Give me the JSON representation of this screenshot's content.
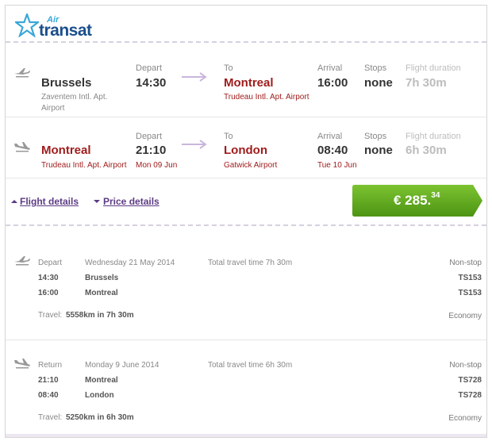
{
  "brand": {
    "air": "Air",
    "transat": "transat"
  },
  "outbound": {
    "from_city": "Brussels",
    "from_airport": "Zaventem Intl. Apt. Airport",
    "depart_label": "Depart",
    "depart_time": "14:30",
    "to_label": "To",
    "to_city": "Montreal",
    "to_airport": "Trudeau Intl. Apt. Airport",
    "arrival_label": "Arrival",
    "arrival_time": "16:00",
    "stops_label": "Stops",
    "stops": "none",
    "duration_label": "Flight duration",
    "duration": "7h 30m"
  },
  "return": {
    "from_city": "Montreal",
    "from_airport": "Trudeau Intl. Apt. Airport",
    "depart_label": "Depart",
    "depart_time": "21:10",
    "depart_date": "Mon 09 Jun",
    "to_label": "To",
    "to_city": "London",
    "to_airport": "Gatwick Airport",
    "arrival_label": "Arrival",
    "arrival_time": "08:40",
    "arrival_date": "Tue 10 Jun",
    "stops_label": "Stops",
    "stops": "none",
    "duration_label": "Flight duration",
    "duration": "6h 30m"
  },
  "actions": {
    "flight_details": "Flight details",
    "price_details": "Price details",
    "price_main": "€ 285.",
    "price_cents": "34"
  },
  "details": {
    "outbound": {
      "type": "Depart",
      "date": "Wednesday 21 May 2014",
      "total_travel": "Total travel time 7h 30m",
      "stops": "Non-stop",
      "legs": [
        {
          "time": "14:30",
          "city": "Brussels",
          "flight": "TS153"
        },
        {
          "time": "16:00",
          "city": "Montreal",
          "flight": "TS153"
        }
      ],
      "travel_prefix": "Travel:",
      "travel_summary": "5558km in 7h 30m",
      "class": "Economy"
    },
    "return": {
      "type": "Return",
      "date": "Monday 9 June 2014",
      "total_travel": "Total travel time 6h 30m",
      "stops": "Non-stop",
      "legs": [
        {
          "time": "21:10",
          "city": "Montreal",
          "flight": "TS728"
        },
        {
          "time": "08:40",
          "city": "London",
          "flight": "TS728"
        }
      ],
      "travel_prefix": "Travel:",
      "travel_summary": "5250km in 6h 30m",
      "class": "Economy"
    }
  },
  "colors": {
    "accent_red": "#a01c1c",
    "link_purple": "#5c3b84",
    "price_green": "#5aa01c",
    "brand_blue": "#1a4f8b"
  }
}
